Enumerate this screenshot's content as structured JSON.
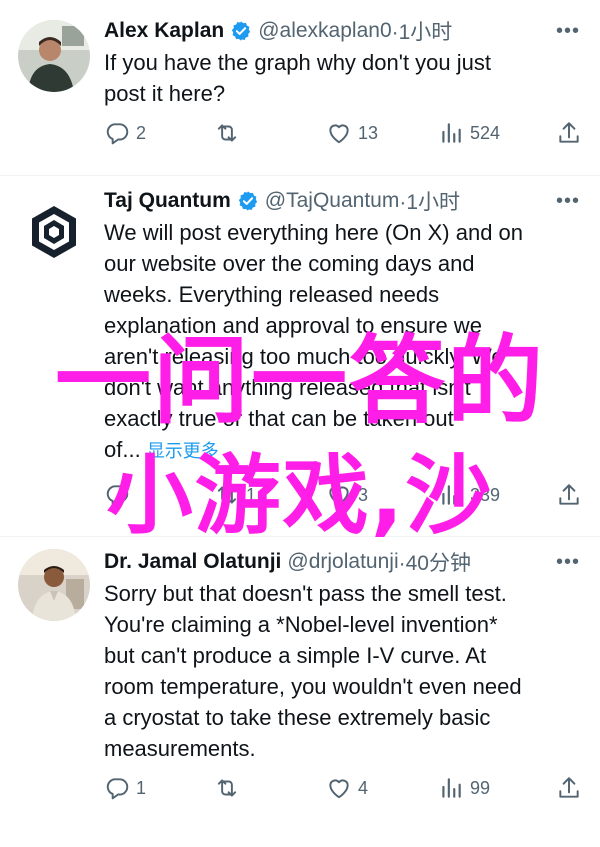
{
  "tweets": [
    {
      "name": "Alex Kaplan",
      "handle": "@alexkaplan0",
      "time": "·1小时",
      "lines": [
        "If you have the graph why don't you just",
        "post it here?"
      ],
      "replies": "2",
      "reposts": "",
      "likes": "13",
      "views": "524"
    },
    {
      "name": "Taj Quantum",
      "handle": "@TajQuantum",
      "time": "·1小时",
      "lines": [
        "We will post everything here (On X) and on",
        "our website over the coming days and",
        "weeks. Everything released needs",
        "explanation and approval to ensure we",
        "aren't releasing too much too quickly. We",
        "don't want anything released that isn't",
        "exactly true or that can be taken out",
        "of..."
      ],
      "show_more": "显示更多",
      "replies": "",
      "reposts": "1",
      "likes": "3",
      "views": "339"
    },
    {
      "name": "Dr. Jamal Olatunji",
      "handle": "@drjolatunji",
      "time": "·40分钟",
      "lines": [
        "Sorry but that doesn't pass the smell test.",
        "You're claiming a *Nobel-level invention*",
        "but can't produce a simple I-V curve. At",
        "room temperature, you wouldn't even need",
        "a cryostat to take these extremely basic",
        "measurements."
      ],
      "replies": "1",
      "reposts": "",
      "likes": "4",
      "views": "99"
    }
  ],
  "overlay": {
    "line1": "一问一答的",
    "line2": "小游戏,沙"
  },
  "colors": {
    "text": "#0f1419",
    "secondary": "#536471",
    "verified": "#1d9bf0",
    "overlay": "#ff1ee8"
  },
  "icons": [
    "reply-icon",
    "repost-icon",
    "like-icon",
    "views-icon",
    "share-icon",
    "verified-badge-icon",
    "more-icon"
  ]
}
